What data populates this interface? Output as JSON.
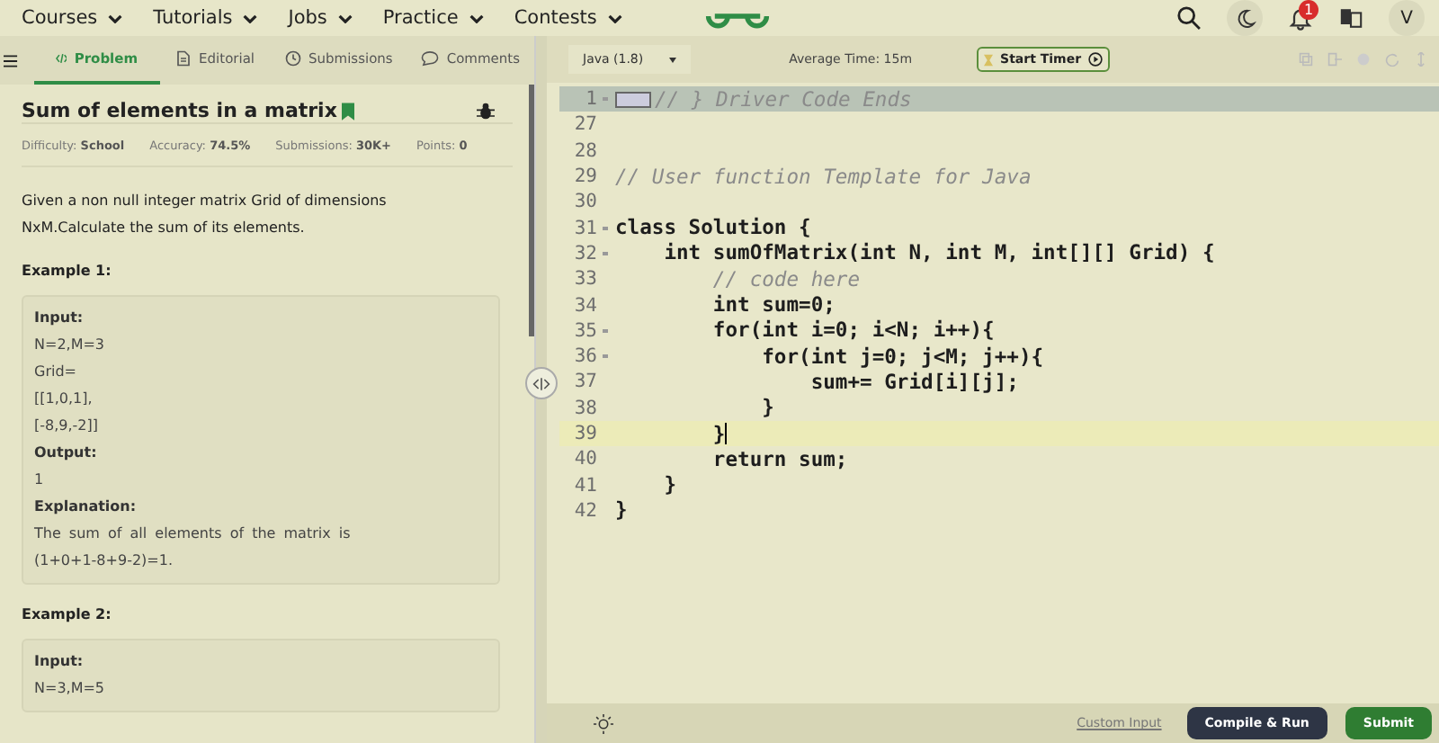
{
  "nav": {
    "menus": [
      {
        "label": "Courses"
      },
      {
        "label": "Tutorials"
      },
      {
        "label": "Jobs"
      },
      {
        "label": "Practice"
      },
      {
        "label": "Contests"
      }
    ],
    "notification_count": "1",
    "avatar": "V"
  },
  "tabs": [
    {
      "label": "Problem",
      "selected": true,
      "kind": "code"
    },
    {
      "label": "Editorial",
      "selected": false,
      "kind": "doc"
    },
    {
      "label": "Submissions",
      "selected": false,
      "kind": "clock"
    },
    {
      "label": "Comments",
      "selected": false,
      "kind": "chat"
    }
  ],
  "problem": {
    "title": "Sum of elements in a matrix",
    "stats": [
      {
        "label": "Difficulty:",
        "value": "School"
      },
      {
        "label": "Accuracy:",
        "value": "74.5%"
      },
      {
        "label": "Submissions:",
        "value": "30K+"
      },
      {
        "label": "Points:",
        "value": "0"
      }
    ],
    "description": "Given a non null integer matrix Grid of dimensions NxM.Calculate the sum of its elements.",
    "examples": [
      {
        "heading": "Example 1:",
        "lines": [
          {
            "kind": "label",
            "text": "Input:"
          },
          {
            "kind": "text",
            "text": "N=2,M=3"
          },
          {
            "kind": "text",
            "text": "Grid="
          },
          {
            "kind": "text",
            "text": "[[1,0,1],"
          },
          {
            "kind": "text",
            "text": "[-8,9,-2]]"
          },
          {
            "kind": "label",
            "text": "Output:"
          },
          {
            "kind": "text",
            "text": "1"
          },
          {
            "kind": "label",
            "text": "Explanation:"
          },
          {
            "kind": "text",
            "text": "The sum of all elements of the matrix is (1+0+1-8+9-2)=1."
          }
        ]
      },
      {
        "heading": "Example 2:",
        "lines": [
          {
            "kind": "label",
            "text": "Input:"
          },
          {
            "kind": "text",
            "text": "N=3,M=5"
          }
        ]
      }
    ]
  },
  "editor": {
    "language": "Java (1.8)",
    "average_time": "Average Time: 15m",
    "timer_button": "Start Timer",
    "lines": [
      {
        "num": "1",
        "text": "// } Driver Code Ends",
        "kind": "comment",
        "fold": true,
        "collapsed": true,
        "active": false
      },
      {
        "num": "27",
        "fold": false,
        "collapsed": false,
        "active": false
      },
      {
        "num": "28",
        "fold": false,
        "collapsed": false,
        "active": false
      },
      {
        "num": "29",
        "text": "// User function Template for Java",
        "kind": "comment",
        "fold": false,
        "collapsed": false,
        "active": false
      },
      {
        "num": "30",
        "fold": false,
        "collapsed": false,
        "active": false
      },
      {
        "num": "31",
        "text": "class Solution {",
        "kind": "code",
        "fold": true,
        "collapsed": false,
        "active": false
      },
      {
        "num": "32",
        "text": "    int sumOfMatrix(int N, int M, int[][] Grid) {",
        "kind": "code",
        "fold": true,
        "collapsed": false,
        "active": false
      },
      {
        "num": "33",
        "text": "        // code here",
        "kind": "comment",
        "fold": false,
        "collapsed": false,
        "active": false
      },
      {
        "num": "34",
        "text": "        int sum=0;",
        "kind": "code",
        "fold": false,
        "collapsed": false,
        "active": false
      },
      {
        "num": "35",
        "text": "        for(int i=0; i<N; i++){",
        "kind": "code",
        "fold": true,
        "collapsed": false,
        "active": false
      },
      {
        "num": "36",
        "text": "            for(int j=0; j<M; j++){",
        "kind": "code",
        "fold": true,
        "collapsed": false,
        "active": false
      },
      {
        "num": "37",
        "text": "                sum+= Grid[i][j];",
        "kind": "code",
        "fold": false,
        "collapsed": false,
        "active": false
      },
      {
        "num": "38",
        "text": "            }",
        "kind": "code",
        "fold": false,
        "collapsed": false,
        "active": false
      },
      {
        "num": "39",
        "text": "        }",
        "kind": "code",
        "fold": false,
        "collapsed": false,
        "active": true
      },
      {
        "num": "40",
        "text": "        return sum;",
        "kind": "code",
        "fold": false,
        "collapsed": false,
        "active": false
      },
      {
        "num": "41",
        "text": "    }",
        "kind": "code",
        "fold": false,
        "collapsed": false,
        "active": false
      },
      {
        "num": "42",
        "text": "}",
        "kind": "code",
        "fold": false,
        "collapsed": false,
        "active": false
      }
    ],
    "custom_input": "Custom Input",
    "compile_button": "Compile & Run",
    "submit_button": "Submit"
  }
}
